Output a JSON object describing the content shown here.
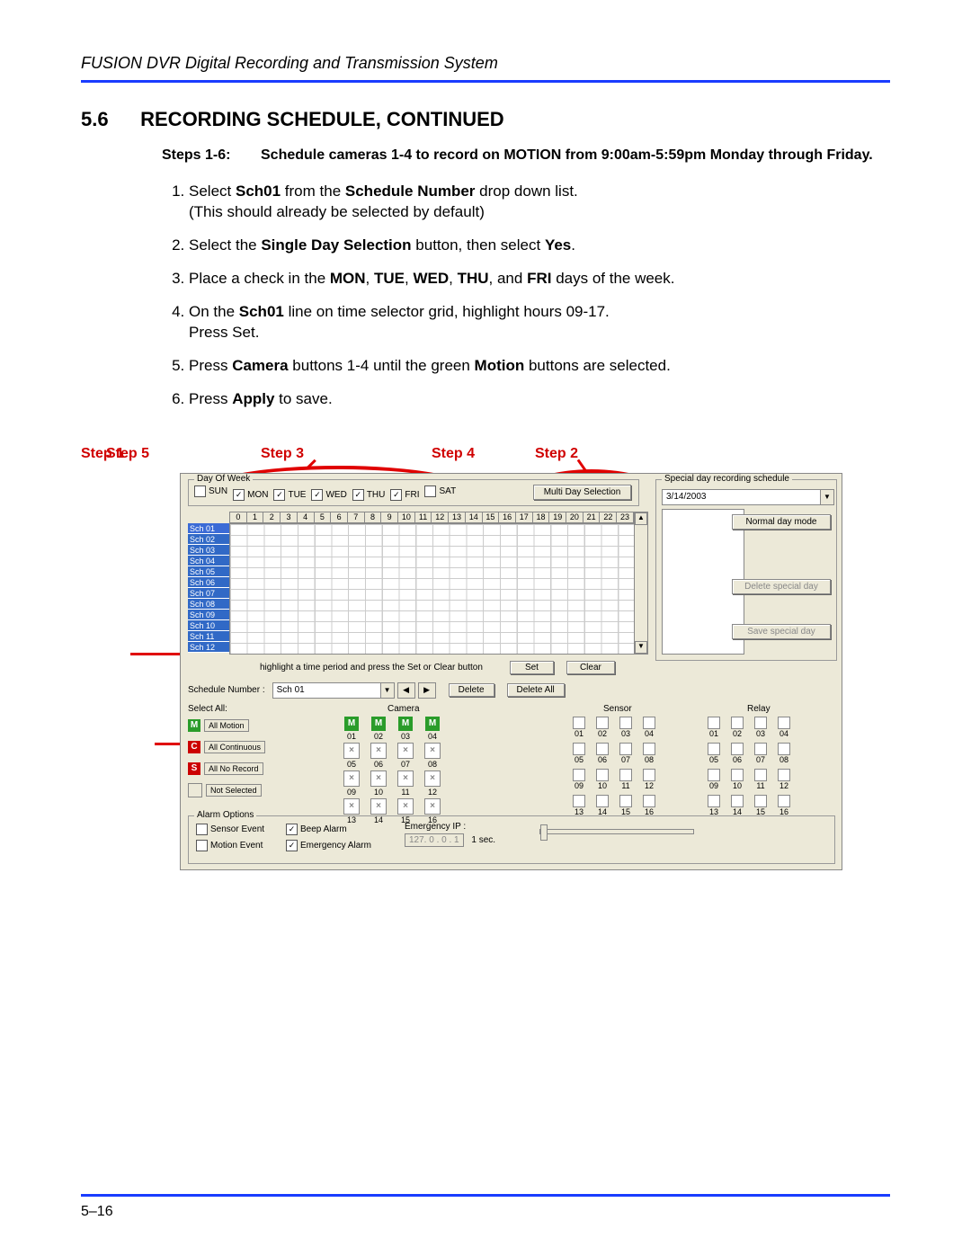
{
  "header": "FUSION DVR Digital Recording and Transmission System",
  "section": {
    "num": "5.6",
    "title": "RECORDING SCHEDULE, CONTINUED"
  },
  "steps_header": {
    "label": "Steps 1-6:",
    "body": "Schedule cameras 1-4 to record on MOTION from 9:00am-5:59pm Monday through Friday."
  },
  "steps": [
    {
      "pre": "Select ",
      "b1": "Sch01",
      "mid1": " from the ",
      "b2": "Schedule Number",
      "tail": " drop down list.\n(This should already be selected by default)"
    },
    {
      "pre": "Select the ",
      "b1": "Single Day Selection",
      "mid1": " button, then select ",
      "b2": "Yes",
      "tail": "."
    },
    {
      "pre": "Place a check in the ",
      "b1": "MON",
      "mid1": ", ",
      "b2": "TUE",
      "mid2": ", ",
      "b3": "WED",
      "mid3": ", ",
      "b4": "THU",
      "mid4": ", and ",
      "b5": "FRI",
      "tail": " days of the week."
    },
    {
      "pre": "On the ",
      "b1": "Sch01",
      "mid1": " line on time selector grid, highlight hours 09-17.\nPress Set.",
      "tail": ""
    },
    {
      "pre": "Press ",
      "b1": "Camera",
      "mid1": " buttons 1-4 until the green ",
      "b2": "Motion",
      "tail": " buttons are selected."
    },
    {
      "pre": "Press ",
      "b1": "Apply",
      "tail": " to save."
    }
  ],
  "page_number": "5–16",
  "annotations": {
    "step1": "Step 1",
    "step2": "Step 2",
    "step3": "Step 3",
    "step4": "Step 4",
    "step5": "Step 5"
  },
  "ui": {
    "dayofweek": {
      "legend": "Day Of Week",
      "days": [
        {
          "label": "SUN",
          "checked": false
        },
        {
          "label": "MON",
          "checked": true
        },
        {
          "label": "TUE",
          "checked": true
        },
        {
          "label": "WED",
          "checked": true
        },
        {
          "label": "THU",
          "checked": true
        },
        {
          "label": "FRI",
          "checked": true
        },
        {
          "label": "SAT",
          "checked": false
        }
      ],
      "multi_btn": "Multi Day Selection"
    },
    "hours": [
      "0",
      "1",
      "2",
      "3",
      "4",
      "5",
      "6",
      "7",
      "8",
      "9",
      "10",
      "11",
      "12",
      "13",
      "14",
      "15",
      "16",
      "17",
      "18",
      "19",
      "20",
      "21",
      "22",
      "23"
    ],
    "schedule_rows": [
      "Sch 01",
      "Sch 02",
      "Sch 03",
      "Sch 04",
      "Sch 05",
      "Sch 06",
      "Sch 07",
      "Sch 08",
      "Sch 09",
      "Sch 10",
      "Sch 11",
      "Sch 12"
    ],
    "special": {
      "legend": "Special day recording schedule",
      "date": "3/14/2003",
      "normal_btn": "Normal day mode",
      "delete_btn": "Delete special day",
      "save_btn": "Save special day"
    },
    "instr": "highlight a time period and press the Set or Clear button",
    "set_btn": "Set",
    "clear_btn": "Clear",
    "sched_num_label": "Schedule Number :",
    "sched_num_value": "Sch 01",
    "delete_btn": "Delete",
    "delete_all_btn": "Delete All",
    "select_all": "Select All:",
    "camera_label": "Camera",
    "sensor_label": "Sensor",
    "relay_label": "Relay",
    "sel_buttons": [
      {
        "icon": "M",
        "cls": "green",
        "text": "All Motion"
      },
      {
        "icon": "C",
        "cls": "red",
        "text": "All Continuous"
      },
      {
        "icon": "S",
        "cls": "grey",
        "text": "All No Record"
      },
      {
        "icon": "",
        "cls": "blank",
        "text": "Not Selected"
      }
    ],
    "camera_row1": [
      {
        "n": "01",
        "state": "M"
      },
      {
        "n": "02",
        "state": "M"
      },
      {
        "n": "03",
        "state": "M"
      },
      {
        "n": "04",
        "state": "M"
      }
    ],
    "camera_rest": [
      [
        "05",
        "06",
        "07",
        "08"
      ],
      [
        "09",
        "10",
        "11",
        "12"
      ],
      [
        "13",
        "14",
        "15",
        "16"
      ]
    ],
    "sr_rows": [
      [
        "01",
        "02",
        "03",
        "04"
      ],
      [
        "05",
        "06",
        "07",
        "08"
      ],
      [
        "09",
        "10",
        "11",
        "12"
      ],
      [
        "13",
        "14",
        "15",
        "16"
      ]
    ],
    "alarm": {
      "legend": "Alarm Options",
      "sensor_event": "Sensor Event",
      "motion_event": "Motion Event",
      "beep_alarm": "Beep Alarm",
      "emergency_alarm": "Emergency Alarm",
      "emergency_ip_label": "Emergency IP :",
      "emergency_ip": "127. 0 . 0 . 1",
      "sec": "1 sec."
    }
  }
}
